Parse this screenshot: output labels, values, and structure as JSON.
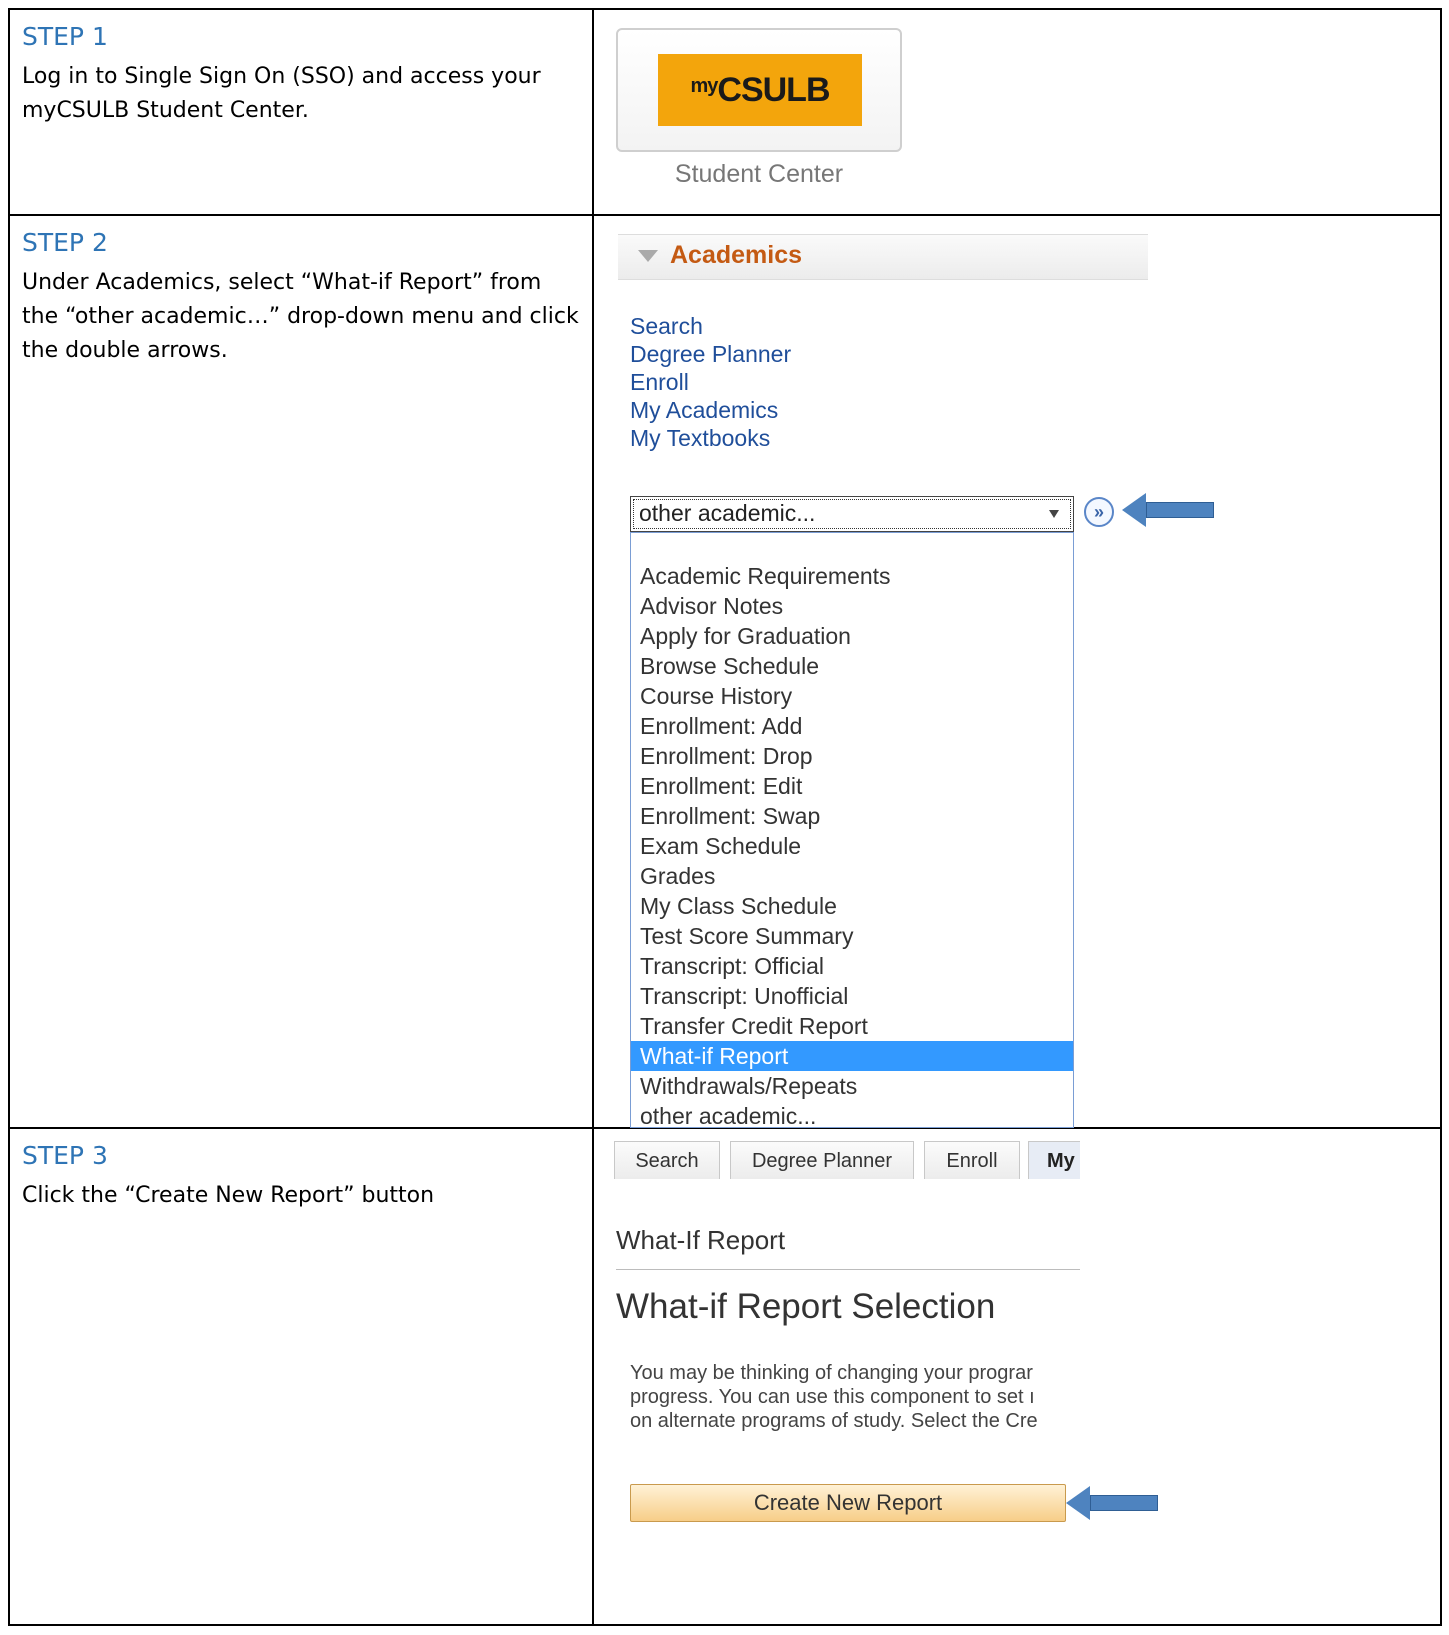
{
  "steps": [
    {
      "title": "STEP 1",
      "text": "Log in to Single Sign On (SSO) and access your myCSULB Student Center."
    },
    {
      "title": "STEP 2",
      "text": "Under Academics, select “What-if Report” from the “other academic…” drop-down menu and click the double arrows."
    },
    {
      "title": "STEP 3",
      "text": "Click the “Create New Report” button"
    }
  ],
  "step1_shot": {
    "logo_prefix": "my",
    "logo_main": "CSULB",
    "caption": "Student Center",
    "logo_color": "#f3a50c"
  },
  "step2_shot": {
    "section_title": "Academics",
    "links": [
      "Search",
      "Degree Planner",
      "Enroll",
      "My Academics",
      "My Textbooks"
    ],
    "select_value": "other academic...",
    "go_button_glyph": "»",
    "dropdown_items": [
      "Academic Requirements",
      "Advisor Notes",
      "Apply for Graduation",
      "Browse Schedule",
      "Course History",
      "Enrollment: Add",
      "Enrollment: Drop",
      "Enrollment: Edit",
      "Enrollment: Swap",
      "Exam Schedule",
      "Grades",
      "My Class Schedule",
      "Test Score Summary",
      "Transcript: Official",
      "Transcript: Unofficial",
      "Transfer Credit Report",
      "What-if Report",
      "Withdrawals/Repeats",
      "other academic..."
    ],
    "selected_item": "What-if Report",
    "highlight_color": "#3399ff"
  },
  "step3_shot": {
    "tabs": [
      "Search",
      "Degree Planner",
      "Enroll",
      "My A"
    ],
    "header": "What-If Report",
    "title": "What-if Report Selection",
    "description_lines": [
      "You may be thinking of changing your prograr",
      "progress. You can use this component to set ı",
      "on alternate programs of study. Select the Cre"
    ],
    "button_label": "Create New Report"
  },
  "colors": {
    "step_title": "#2e74b5",
    "arrow": "#4e83bf",
    "link": "#1f4e9a"
  }
}
